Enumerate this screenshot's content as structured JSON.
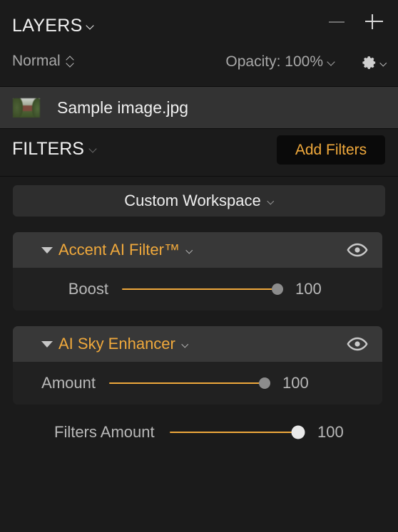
{
  "layers_panel": {
    "title": "LAYERS",
    "title_chevron_icon": "chevron-down-icon",
    "minimize_icon": "minus-icon",
    "add_layer_icon": "plus-icon",
    "blend_mode": "Normal",
    "blend_mode_icon": "chevron-up-down-icon",
    "opacity": "Opacity: 100%",
    "opacity_chevron_icon": "chevron-down-icon",
    "settings_icon": "gear-icon",
    "settings_chevron_icon": "chevron-down-icon"
  },
  "layer": {
    "name": "Sample image.jpg",
    "thumbnail_icon": "layer-thumbnail"
  },
  "filters_panel": {
    "title": "FILTERS",
    "title_chevron_icon": "chevron-down-icon",
    "add_filters_label": "Add Filters",
    "workspace": "Custom Workspace",
    "workspace_chevron_icon": "chevron-down-icon"
  },
  "filters": [
    {
      "name": "Accent AI Filter™",
      "expanded": true,
      "collapse_icon": "triangle-down-icon",
      "menu_icon": "chevron-down-icon",
      "visibility_icon": "eye-icon",
      "slider": {
        "label": "Boost",
        "value": "100",
        "fill_percent": 100,
        "knob_style": "gray"
      }
    },
    {
      "name": "AI Sky Enhancer",
      "expanded": true,
      "collapse_icon": "triangle-down-icon",
      "menu_icon": "chevron-down-icon",
      "visibility_icon": "eye-icon",
      "slider": {
        "label": "Amount",
        "value": "100",
        "fill_percent": 100,
        "knob_style": "gray"
      }
    }
  ],
  "filters_amount": {
    "label": "Filters Amount",
    "value": "100",
    "fill_percent": 100,
    "knob_style": "light"
  },
  "colors": {
    "accent": "#f0a93c",
    "panel_bg": "#1b1b1b",
    "card_bg": "#212121",
    "card_header_bg": "#383838",
    "layer_row_bg": "#333333",
    "text": "#f0f0f0",
    "muted_text": "#b9b9b9"
  }
}
